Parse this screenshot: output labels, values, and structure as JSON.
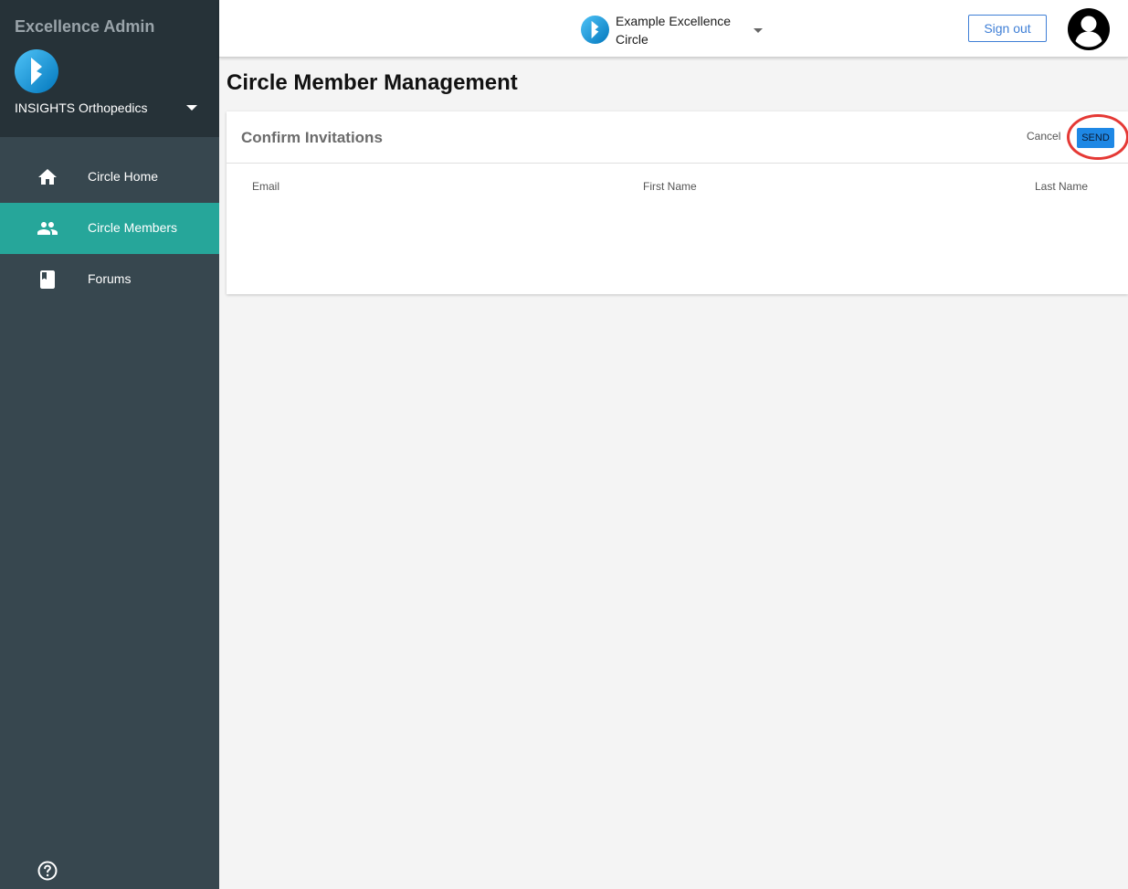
{
  "sidebar": {
    "app_title": "Excellence Admin",
    "org_name": "INSIGHTS Orthopedics",
    "items": [
      {
        "label": "Circle Home",
        "icon": "home-icon",
        "active": false
      },
      {
        "label": "Circle Members",
        "icon": "people-icon",
        "active": true
      },
      {
        "label": "Forums",
        "icon": "book-icon",
        "active": false
      }
    ],
    "help_icon": "help-icon"
  },
  "topbar": {
    "circle_name": "Example Excellence Circle",
    "sign_out_label": "Sign out"
  },
  "main": {
    "page_title": "Circle Member Management",
    "card": {
      "title": "Confirm Invitations",
      "cancel_label": "Cancel",
      "send_label": "SEND",
      "columns": [
        "Email",
        "First Name",
        "Last Name"
      ],
      "rows": []
    }
  },
  "colors": {
    "sidebar_bg": "#37474f",
    "sidebar_header_bg": "#263238",
    "active_nav": "#26a69a",
    "primary_button": "#1e88e5",
    "sign_out_border": "#3f7fd6",
    "highlight_ring": "#e53935"
  }
}
